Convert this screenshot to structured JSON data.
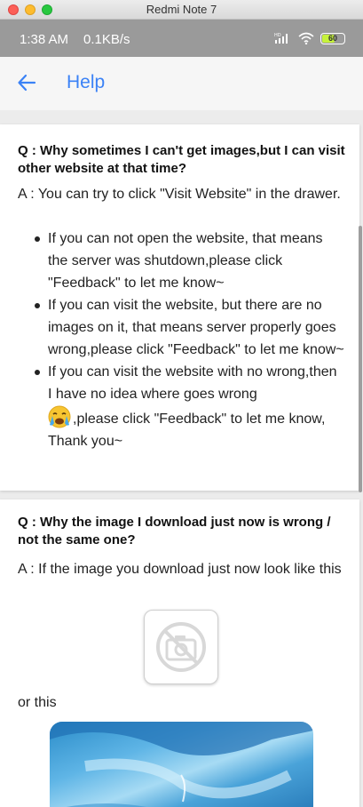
{
  "window": {
    "title": "Redmi Note 7"
  },
  "status_bar": {
    "time": "1:38 AM",
    "speed": "0.1KB/s",
    "battery_level": "60",
    "battery_fraction": 0.6
  },
  "appbar": {
    "title": "Help"
  },
  "faq": [
    {
      "question": "Q : Why sometimes I can't get images,but I can visit other website at that time?",
      "answer_intro": "A : You can try to click \"Visit Website\" in the drawer.",
      "bullets": [
        "If you can not open the website, that means the server was shutdown,please click \"Feedback\" to let me know~",
        "If you can visit the website, but there are no images on it, that means server properly goes wrong,please click \"Feedback\" to let me know~",
        "If you can visit the website with no wrong,then I have no idea where goes wrong",
        ",please click \"Feedback\" to let me know, Thank you~"
      ]
    },
    {
      "question": "Q : Why the image I download just now is wrong / not the same one?",
      "answer_intro": "A : If the image you download just now look like this",
      "answer_or": "or this"
    }
  ],
  "colors": {
    "accent": "#3b82f6",
    "statusbar": "#9a9a9a",
    "appbar": "#f6f6f6"
  }
}
